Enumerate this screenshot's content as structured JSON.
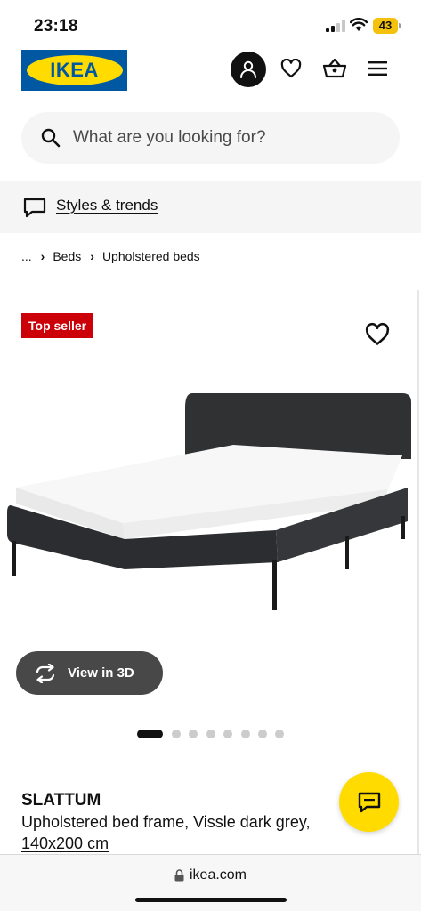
{
  "status_bar": {
    "time": "23:18",
    "battery": "43",
    "icons": [
      "signal-icon",
      "wifi-icon",
      "battery-icon"
    ]
  },
  "header": {
    "logo_text": "IKEA",
    "icons": [
      "profile-icon",
      "heart-icon",
      "basket-icon",
      "menu-icon"
    ]
  },
  "search": {
    "placeholder": "What are you looking for?",
    "value": ""
  },
  "styles_link": {
    "label": "Styles & trends",
    "icon": "chat-bubble-icon"
  },
  "breadcrumb": {
    "ellipsis": "...",
    "separator": "›",
    "items": [
      "Beds",
      "Upholstered beds"
    ]
  },
  "product": {
    "badge": "Top seller",
    "name": "SLATTUM",
    "description": "Upholstered bed frame, Vissle dark grey,",
    "size": "140x200 cm",
    "view_3d_label": "View in 3D",
    "image_count": 8,
    "active_image": 1
  },
  "chat": {
    "icon": "chat-icon"
  },
  "browser": {
    "url": "ikea.com"
  },
  "colors": {
    "ikea_blue": "#0058a3",
    "ikea_yellow": "#ffdb00",
    "badge_red": "#cc0008",
    "dark": "#111111",
    "bed_fabric": "#2f3133",
    "mattress": "#f7f7f7"
  }
}
